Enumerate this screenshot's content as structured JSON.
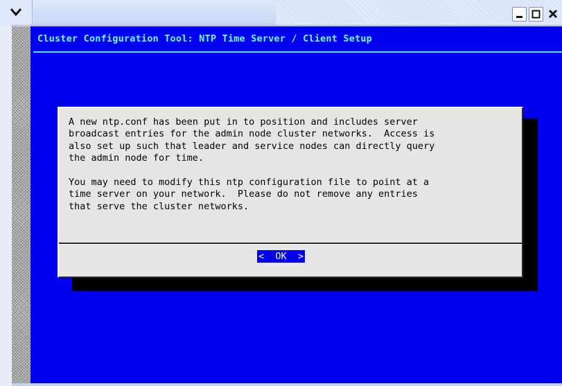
{
  "window": {
    "title": "Cluster Configuration Tool: NTP Time Server / Client Setup",
    "buttons": [
      "menu-icon",
      "minimize-icon",
      "maximize-icon",
      "close-icon"
    ]
  },
  "dialog": {
    "message": "A new ntp.conf has been put in to position and includes server\nbroadcast entries for the admin node cluster networks.  Access is\nalso set up such that leader and service nodes can directly query\nthe admin node for time.\n\nYou may need to modify this ntp configuration file to point at a\ntime server on your network.  Please do not remove any entries\nthat serve the cluster networks.",
    "ok_button": {
      "open": "<",
      "hotkey": "O",
      "rest": "K",
      "close": ">"
    }
  },
  "colors": {
    "terminal_bg": "#0000ee",
    "title_text": "#66ffff",
    "dialog_bg": "#e6e6e6",
    "hotkey": "#ffff55"
  }
}
